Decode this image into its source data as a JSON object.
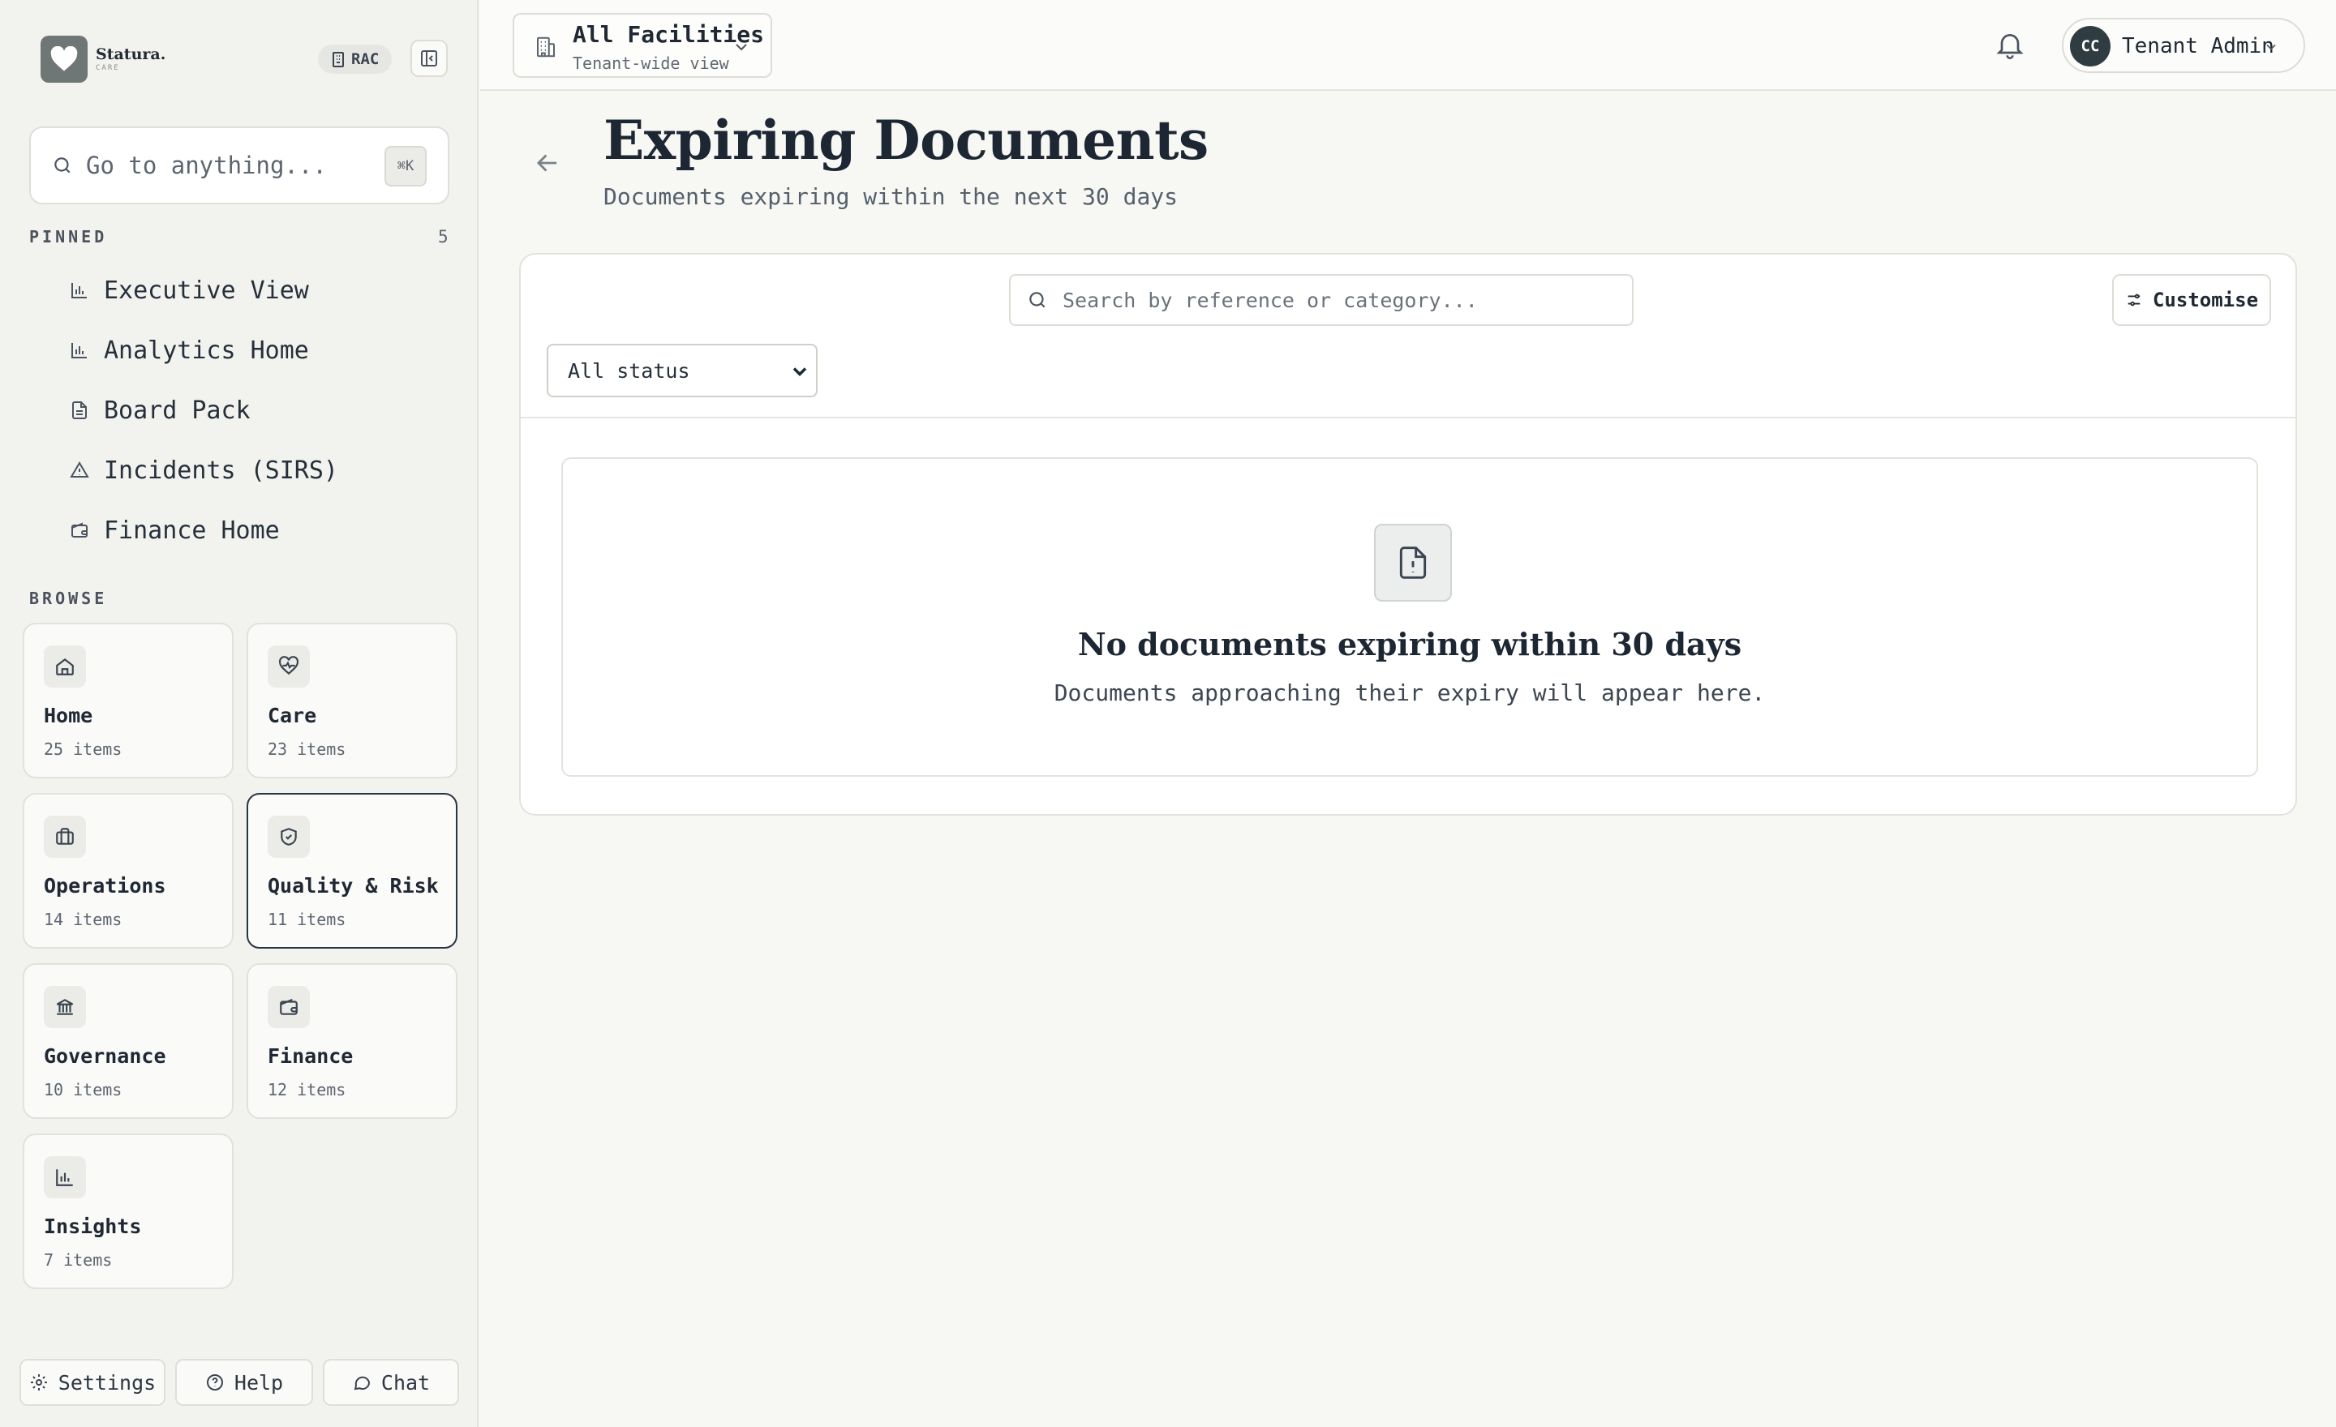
{
  "brand": {
    "name": "Statura.",
    "sub": "CARE"
  },
  "sidebar": {
    "badge": "RAC",
    "search": {
      "placeholder": "Go to anything...",
      "shortcut": "⌘K"
    },
    "pinned": {
      "label": "PINNED",
      "count": "5",
      "items": [
        {
          "label": "Executive View",
          "icon": "bar-chart-icon"
        },
        {
          "label": "Analytics Home",
          "icon": "bar-chart-icon"
        },
        {
          "label": "Board Pack",
          "icon": "document-icon"
        },
        {
          "label": "Incidents (SIRS)",
          "icon": "warning-icon"
        },
        {
          "label": "Finance Home",
          "icon": "wallet-icon"
        }
      ]
    },
    "browse": {
      "label": "BROWSE",
      "categories": [
        {
          "title": "Home",
          "count": "25 items",
          "icon": "home-icon"
        },
        {
          "title": "Care",
          "count": "23 items",
          "icon": "heart-pulse-icon"
        },
        {
          "title": "Operations",
          "count": "14 items",
          "icon": "briefcase-icon"
        },
        {
          "title": "Quality & Risk",
          "count": "11 items",
          "icon": "shield-check-icon",
          "selected": true
        },
        {
          "title": "Governance",
          "count": "10 items",
          "icon": "landmark-icon"
        },
        {
          "title": "Finance",
          "count": "12 items",
          "icon": "wallet-icon"
        },
        {
          "title": "Insights",
          "count": "7 items",
          "icon": "bar-chart-icon"
        }
      ]
    },
    "footer": {
      "settings": "Settings",
      "help": "Help",
      "chat": "Chat"
    }
  },
  "topbar": {
    "facility": {
      "title": "All Facilities",
      "subtitle": "Tenant-wide view"
    },
    "user": {
      "initials": "CC",
      "name": "Tenant Admin"
    }
  },
  "main": {
    "title": "Expiring Documents",
    "subtitle": "Documents expiring within the next 30 days",
    "search": {
      "placeholder": "Search by reference or category..."
    },
    "customise": "Customise",
    "status_filter": {
      "selected": "All status"
    },
    "empty": {
      "title": "No documents expiring within 30 days",
      "subtitle": "Documents approaching their expiry will appear here."
    }
  },
  "colors": {
    "background": "#f7f7f4",
    "sidebar": "#f2f2ee",
    "text": "#1f2733",
    "brand_logo": "#6f7776",
    "avatar": "#2f3d42"
  }
}
